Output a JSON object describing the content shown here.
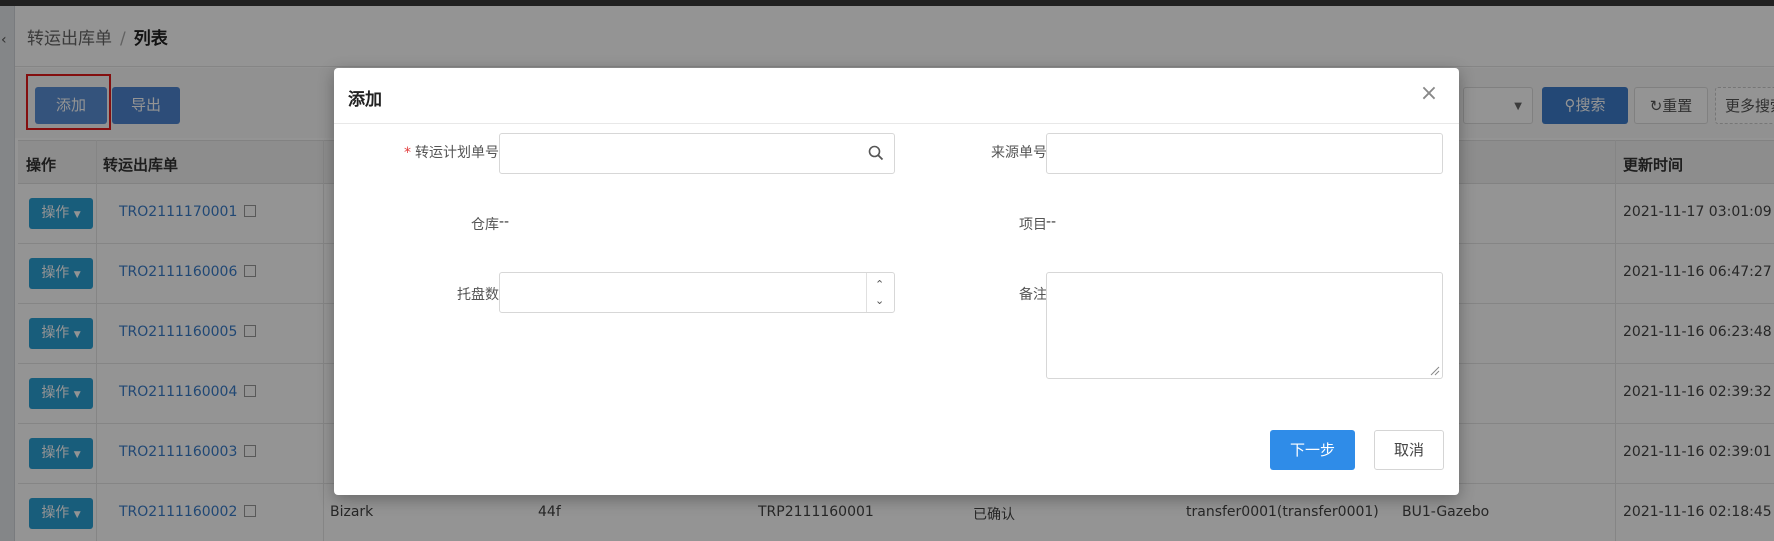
{
  "breadcrumb": {
    "parent": "转运出库单",
    "separator": "/",
    "current": "列表"
  },
  "toolbar": {
    "add_label": "添加",
    "export_label": "导出",
    "search_label": "搜索",
    "reset_label": "重置",
    "more_search_label": "更多搜索"
  },
  "table": {
    "headers": {
      "op": "操作",
      "code": "转运出库单",
      "time": "更新时间"
    },
    "op_label": "操作",
    "rows": [
      {
        "code": "TRO2111170001",
        "c3": "",
        "c4": "",
        "c5": "",
        "c6": "",
        "c7": "",
        "c8": "",
        "time": "2021-11-17 03:01:09"
      },
      {
        "code": "TRO2111160006",
        "c3": "",
        "c4": "",
        "c5": "",
        "c6": "",
        "c7": "",
        "c8": "",
        "time": "2021-11-16 06:47:27"
      },
      {
        "code": "TRO2111160005",
        "c3": "",
        "c4": "",
        "c5": "",
        "c6": "",
        "c7": "",
        "c8": "",
        "time": "2021-11-16 06:23:48"
      },
      {
        "code": "TRO2111160004",
        "c3": "",
        "c4": "",
        "c5": "",
        "c6": "",
        "c7": "",
        "c8": "",
        "time": "2021-11-16 02:39:32"
      },
      {
        "code": "TRO2111160003",
        "c3": "",
        "c4": "",
        "c5": "",
        "c6": "",
        "c7": "",
        "c8": "",
        "time": "2021-11-16 02:39:01"
      },
      {
        "code": "TRO2111160002",
        "c3": "Bizark",
        "c4": "44f",
        "c5": "TRP2111160001",
        "c6": "已确认",
        "c7": "transfer0001(transfer0001)",
        "c8": "BU1-Gazebo",
        "time": "2021-11-16 02:18:45"
      }
    ]
  },
  "modal": {
    "title": "添加",
    "fields": {
      "plan_no_label": "转运计划单号",
      "source_no_label": "来源单号",
      "warehouse_label": "仓库",
      "warehouse_value": "--",
      "project_label": "项目",
      "project_value": "--",
      "pallet_label": "托盘数",
      "remark_label": "备注"
    },
    "next_label": "下一步",
    "cancel_label": "取消"
  },
  "colors": {
    "primary": "#2f8ce8",
    "op_button": "#2aa0d4",
    "link": "#3a7cc9",
    "required": "#e23b3b",
    "highlight": "#e31a1a"
  }
}
